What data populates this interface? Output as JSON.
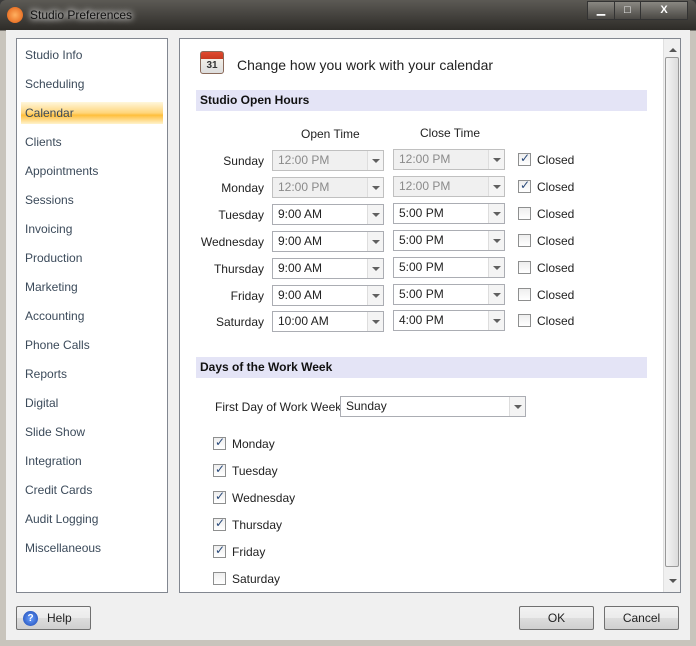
{
  "window": {
    "title": "Studio Preferences",
    "minimize": "▁",
    "maximize": "□",
    "close": "X"
  },
  "sidebar": {
    "items": [
      "Studio Info",
      "Scheduling",
      "Calendar",
      "Clients",
      "Appointments",
      "Sessions",
      "Invoicing",
      "Production",
      "Marketing",
      "Accounting",
      "Phone Calls",
      "Reports",
      "Digital",
      "Slide Show",
      "Integration",
      "Credit Cards",
      "Audit Logging",
      "Miscellaneous"
    ],
    "selected": "Calendar"
  },
  "header": {
    "icon": "calendar-icon",
    "icon_text": "31",
    "title": "Change how you work with your calendar"
  },
  "open_hours": {
    "title": "Studio Open Hours",
    "open_col": "Open Time",
    "close_col": "Close Time",
    "closed_label": "Closed",
    "rows": [
      {
        "day": "Sunday",
        "open": "12:00 PM",
        "close": "12:00 PM",
        "closed": true
      },
      {
        "day": "Monday",
        "open": "12:00 PM",
        "close": "12:00 PM",
        "closed": true
      },
      {
        "day": "Tuesday",
        "open": "9:00 AM",
        "close": "5:00 PM",
        "closed": false
      },
      {
        "day": "Wednesday",
        "open": "9:00 AM",
        "close": "5:00 PM",
        "closed": false
      },
      {
        "day": "Thursday",
        "open": "9:00 AM",
        "close": "5:00 PM",
        "closed": false
      },
      {
        "day": "Friday",
        "open": "9:00 AM",
        "close": "5:00 PM",
        "closed": false
      },
      {
        "day": "Saturday",
        "open": "10:00 AM",
        "close": "4:00 PM",
        "closed": false
      }
    ]
  },
  "work_week": {
    "title": "Days of the Work Week",
    "first_day_label": "First Day of Work Week",
    "first_day": "Sunday",
    "days": [
      {
        "label": "Monday",
        "checked": true
      },
      {
        "label": "Tuesday",
        "checked": true
      },
      {
        "label": "Wednesday",
        "checked": true
      },
      {
        "label": "Thursday",
        "checked": true
      },
      {
        "label": "Friday",
        "checked": true
      },
      {
        "label": "Saturday",
        "checked": false
      }
    ]
  },
  "footer": {
    "help": "Help",
    "ok": "OK",
    "cancel": "Cancel"
  }
}
